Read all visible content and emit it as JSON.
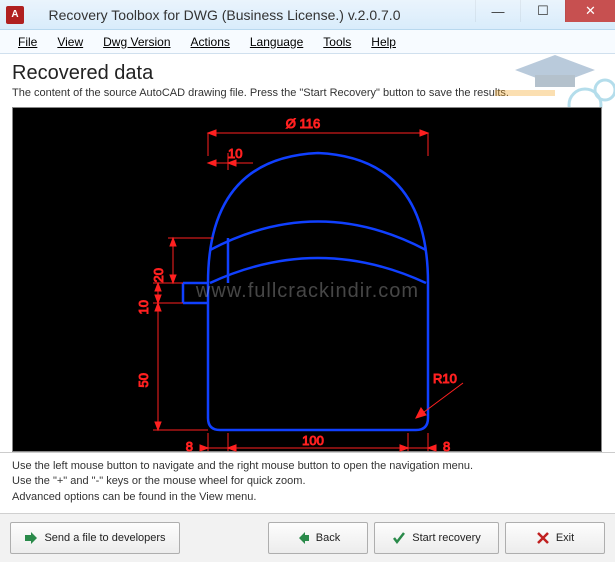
{
  "title": "Recovery Toolbox for DWG (Business License.) v.2.0.7.0",
  "menus": {
    "file": "File",
    "view": "View",
    "dwg": "Dwg Version",
    "actions": "Actions",
    "language": "Language",
    "tools": "Tools",
    "help": "Help"
  },
  "heading": "Recovered data",
  "subheading": "The content of the source AutoCAD drawing file. Press the \"Start Recovery\" button to save the results.",
  "drawing": {
    "diameter": "Ø 116",
    "dim_10_top": "10",
    "dim_20": "20",
    "dim_10_side": "10",
    "dim_50": "50",
    "dim_8_left": "8",
    "dim_8_right": "8",
    "dim_100": "100",
    "radius": "R10"
  },
  "instructions": {
    "line1": "Use the left mouse button to navigate and the right mouse button to open the navigation menu.",
    "line2": "Use the \"+\" and \"-\" keys or the mouse wheel for quick zoom.",
    "line3": "Advanced options can be found in the View menu."
  },
  "buttons": {
    "send": "Send a file to developers",
    "back": "Back",
    "start": "Start recovery",
    "exit": "Exit"
  },
  "watermark": "www.fullcrackindir.com"
}
